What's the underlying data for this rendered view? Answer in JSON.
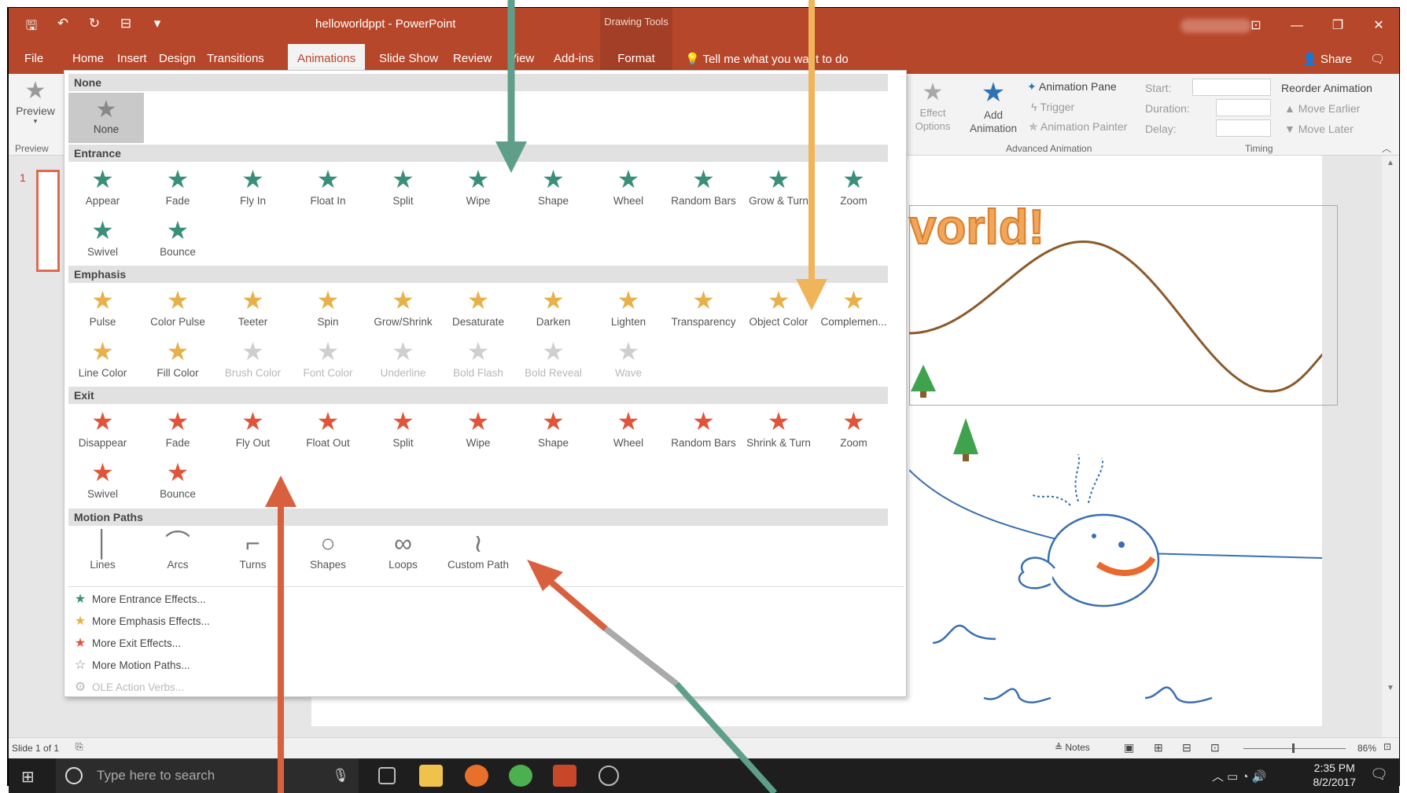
{
  "window": {
    "doc_title": "helloworldppt",
    "app_name": "PowerPoint",
    "drawing_tools": "Drawing Tools",
    "title_sep": " - "
  },
  "qat": [
    "save-icon",
    "undo-icon",
    "redo-icon",
    "present-icon",
    "customize-icon"
  ],
  "tabs": [
    {
      "label": "File"
    },
    {
      "label": "Home"
    },
    {
      "label": "Insert"
    },
    {
      "label": "Design"
    },
    {
      "label": "Transitions"
    },
    {
      "label": "Animations"
    },
    {
      "label": "Slide Show"
    },
    {
      "label": "Review"
    },
    {
      "label": "View"
    },
    {
      "label": "Add-ins"
    },
    {
      "label": "Format"
    }
  ],
  "tell_me": "Tell me what you want to do",
  "share": "Share",
  "ribbon": {
    "preview_label": "Preview",
    "preview_group": "Preview",
    "effect_options": "Effect Options",
    "add_animation": "Add Animation",
    "animation_pane": "Animation Pane",
    "trigger": "Trigger",
    "animation_painter": "Animation Painter",
    "advanced_group": "Advanced Animation",
    "start": "Start:",
    "duration": "Duration:",
    "delay": "Delay:",
    "timing_group": "Timing",
    "reorder": "Reorder Animation",
    "move_earlier": "Move Earlier",
    "move_later": "Move Later"
  },
  "gallery": {
    "none_header": "None",
    "none_item": "None",
    "entrance_header": "Entrance",
    "entrance": [
      "Appear",
      "Fade",
      "Fly In",
      "Float In",
      "Split",
      "Wipe",
      "Shape",
      "Wheel",
      "Random Bars",
      "Grow & Turn",
      "Zoom",
      "Swivel",
      "Bounce"
    ],
    "emphasis_header": "Emphasis",
    "emphasis": [
      "Pulse",
      "Color Pulse",
      "Teeter",
      "Spin",
      "Grow/Shrink",
      "Desaturate",
      "Darken",
      "Lighten",
      "Transparency",
      "Object Color",
      "Complemen...",
      "Line Color",
      "Fill Color",
      "Brush Color",
      "Font Color",
      "Underline",
      "Bold Flash",
      "Bold Reveal",
      "Wave"
    ],
    "exit_header": "Exit",
    "exit": [
      "Disappear",
      "Fade",
      "Fly Out",
      "Float Out",
      "Split",
      "Wipe",
      "Shape",
      "Wheel",
      "Random Bars",
      "Shrink & Turn",
      "Zoom",
      "Swivel",
      "Bounce"
    ],
    "motion_header": "Motion Paths",
    "motion": [
      "Lines",
      "Arcs",
      "Turns",
      "Shapes",
      "Loops",
      "Custom Path"
    ],
    "more": [
      "More Entrance Effects...",
      "More Emphasis Effects...",
      "More Exit Effects...",
      "More Motion Paths...",
      "OLE Action Verbs..."
    ]
  },
  "slide": {
    "text_fragment": "vorld!",
    "thumb_number": "1"
  },
  "status": {
    "slide_of": "Slide 1 of 1",
    "notes": "Notes",
    "zoom": "86%"
  },
  "taskbar": {
    "search_placeholder": "Type here to search",
    "time": "2:35 PM",
    "date": "8/2/2017"
  },
  "colors": {
    "accent": "#b7472a",
    "entrance": "#3a8f7a",
    "emphasis": "#e8b04a",
    "exit": "#e0553a",
    "arrow_teal": "#5f9f8a",
    "arrow_orange": "#f0b45a",
    "arrow_red": "#d9603f"
  }
}
